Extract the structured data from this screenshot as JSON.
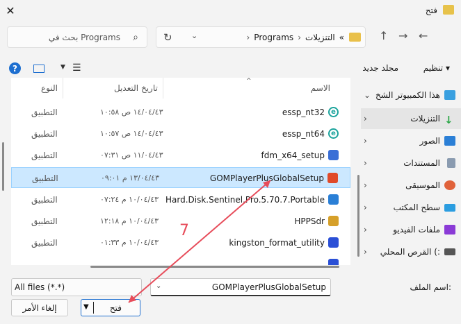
{
  "window": {
    "title": "فتح",
    "close_glyph": "✕"
  },
  "search": {
    "placeholder": "بحث في Programs"
  },
  "address": {
    "crumbs": [
      "«",
      "التنزيلات",
      "›",
      "Programs",
      "›"
    ]
  },
  "toolbar": {
    "organize": "تنظيم ▾",
    "new_folder": "مجلد جديد",
    "help": "?"
  },
  "navpane": {
    "items": [
      {
        "label": "هذا الكمبيوتر الشخ",
        "icon": "computer-icon",
        "color": "#3aa0e0"
      },
      {
        "label": "التنزيلات",
        "icon": "download-icon",
        "color": "#2ea84a",
        "selected": true
      },
      {
        "label": "الصور",
        "icon": "pictures-icon",
        "color": "#2b7fd6"
      },
      {
        "label": "المستندات",
        "icon": "documents-icon",
        "color": "#8a9bb0"
      },
      {
        "label": "الموسيقى",
        "icon": "music-icon",
        "color": "#e0623a"
      },
      {
        "label": "سطح المكتب",
        "icon": "desktop-icon",
        "color": "#2b9de0"
      },
      {
        "label": "ملفات الفيديو",
        "icon": "videos-icon",
        "color": "#8a3ad6"
      },
      {
        "label": "القرص المحلي (:",
        "icon": "drive-icon",
        "color": "#555555"
      }
    ]
  },
  "columns": {
    "name": "الاسم",
    "date": "تاريخ التعديل",
    "type": "النوع"
  },
  "files": [
    {
      "name": "essp_nt32",
      "date": "١٤/٠٤/٤٣ ص ١٠:٥٨",
      "type": "التطبيق",
      "icon": "eset-icon",
      "color": "#1ba39c"
    },
    {
      "name": "essp_nt64",
      "date": "١٤/٠٤/٤٣ ص ١٠:٥٧",
      "type": "التطبيق",
      "icon": "eset-icon",
      "color": "#1ba39c"
    },
    {
      "name": "fdm_x64_setup",
      "date": "١١/٠٤/٤٣ ص ٠٧:٣١",
      "type": "التطبيق",
      "icon": "installer-icon",
      "color": "#3a6fd6"
    },
    {
      "name": "GOMPlayerPlusGlobalSetup",
      "date": "١٣/٠٤/٤٣ م ٠٩:٠١",
      "type": "التطبيق",
      "icon": "gom-icon",
      "color": "#e04a2a",
      "selected": true
    },
    {
      "name": "Hard.Disk.Sentinel.Pro.5.70.7.Portable",
      "date": "١٠/٠٤/٤٣ م ٠٧:٢٤",
      "type": "التطبيق",
      "icon": "hds-icon",
      "color": "#2a7fd6"
    },
    {
      "name": "HPPSdr",
      "date": "١٠/٠٤/٤٣ م ١٢:١٨",
      "type": "التطبيق",
      "icon": "hp-icon",
      "color": "#d6a02a"
    },
    {
      "name": "kingston_format_utility",
      "date": "١٠/٠٤/٤٣ م ٠١:٣٣",
      "type": "التطبيق",
      "icon": "kingston-icon",
      "color": "#2a4fd6"
    }
  ],
  "bottom": {
    "filename_label": "اسم الملف:",
    "filename_value": "GOMPlayerPlusGlobalSetup",
    "filter_value": "All files (*.*)",
    "open_label": "فتح",
    "cancel_label": "إلغاء الأمر"
  },
  "annotation": {
    "step": "7",
    "color": "#e74c5a"
  }
}
